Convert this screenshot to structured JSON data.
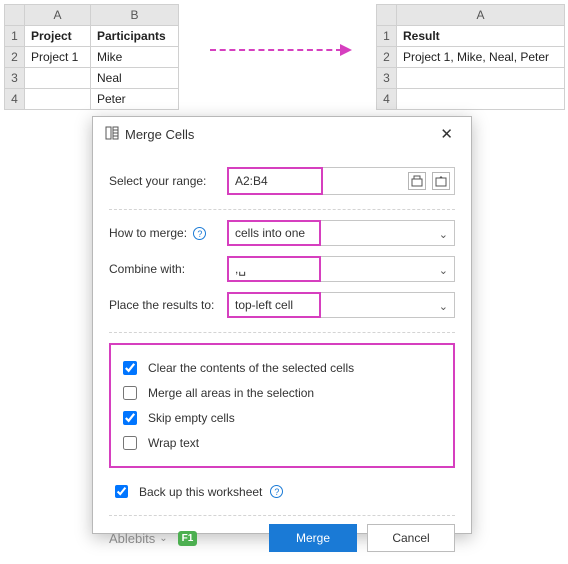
{
  "source_table": {
    "headers": [
      "Project",
      "Participants"
    ],
    "rows": [
      [
        "Project 1",
        "Mike"
      ],
      [
        "",
        "Neal"
      ],
      [
        "",
        "Peter"
      ]
    ]
  },
  "result_table": {
    "header": "Result",
    "value": "Project 1, Mike, Neal, Peter"
  },
  "dialog": {
    "title": "Merge Cells",
    "range_label": "Select your range:",
    "range_value": "A2:B4",
    "how_label": "How to merge:",
    "how_value": "cells into one",
    "combine_label": "Combine with:",
    "combine_value": ",␣",
    "place_label": "Place the results to:",
    "place_value": "top-left cell",
    "checks": {
      "clear": "Clear the contents of the selected cells",
      "merge_areas": "Merge all areas in the selection",
      "skip_empty": "Skip empty cells",
      "wrap": "Wrap text"
    },
    "checked": {
      "clear": true,
      "merge_areas": false,
      "skip_empty": true,
      "wrap": false
    },
    "backup_label": "Back up this worksheet",
    "backup_checked": true,
    "brand": "Ablebits",
    "f1": "F1",
    "merge_btn": "Merge",
    "cancel_btn": "Cancel"
  }
}
